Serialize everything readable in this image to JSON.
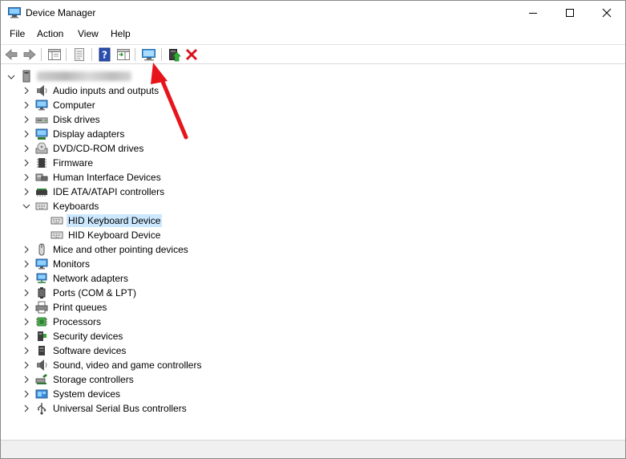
{
  "window": {
    "title": "Device Manager"
  },
  "menu": [
    "File",
    "Action",
    "View",
    "Help"
  ],
  "toolbar": {
    "buttons": [
      "back-icon",
      "forward-icon",
      "show-hide-console-tree-icon",
      "properties-icon",
      "help-icon",
      "action-pane-icon",
      "scan-hardware-changes-icon",
      "update-driver-icon",
      "uninstall-device-icon"
    ]
  },
  "tree": {
    "root_label": "",
    "categories": [
      {
        "label": "Audio inputs and outputs",
        "icon": "speaker-icon"
      },
      {
        "label": "Computer",
        "icon": "monitor-icon"
      },
      {
        "label": "Disk drives",
        "icon": "disk-drive-icon"
      },
      {
        "label": "Display adapters",
        "icon": "display-adapter-icon"
      },
      {
        "label": "DVD/CD-ROM drives",
        "icon": "dvd-drive-icon"
      },
      {
        "label": "Firmware",
        "icon": "chip-icon"
      },
      {
        "label": "Human Interface Devices",
        "icon": "hid-icon"
      },
      {
        "label": "IDE ATA/ATAPI controllers",
        "icon": "ide-controller-icon"
      },
      {
        "label": "Keyboards",
        "icon": "keyboard-icon"
      },
      {
        "label": "HID Keyboard Device",
        "icon": "keyboard-icon"
      },
      {
        "label": "HID Keyboard Device",
        "icon": "keyboard-icon"
      },
      {
        "label": "Mice and other pointing devices",
        "icon": "mouse-icon"
      },
      {
        "label": "Monitors",
        "icon": "monitor-icon"
      },
      {
        "label": "Network adapters",
        "icon": "network-icon"
      },
      {
        "label": "Ports (COM & LPT)",
        "icon": "port-icon"
      },
      {
        "label": "Print queues",
        "icon": "printer-icon"
      },
      {
        "label": "Processors",
        "icon": "processor-icon"
      },
      {
        "label": "Security devices",
        "icon": "security-device-icon"
      },
      {
        "label": "Software devices",
        "icon": "software-device-icon"
      },
      {
        "label": "Sound, video and game controllers",
        "icon": "speaker-icon"
      },
      {
        "label": "Storage controllers",
        "icon": "storage-controller-icon"
      },
      {
        "label": "System devices",
        "icon": "system-device-icon"
      },
      {
        "label": "Universal Serial Bus controllers",
        "icon": "usb-icon"
      }
    ]
  },
  "colors": {
    "selection": "#cce8ff",
    "annotation_arrow": "#e8141c",
    "uninstall_red": "#d8141c"
  }
}
